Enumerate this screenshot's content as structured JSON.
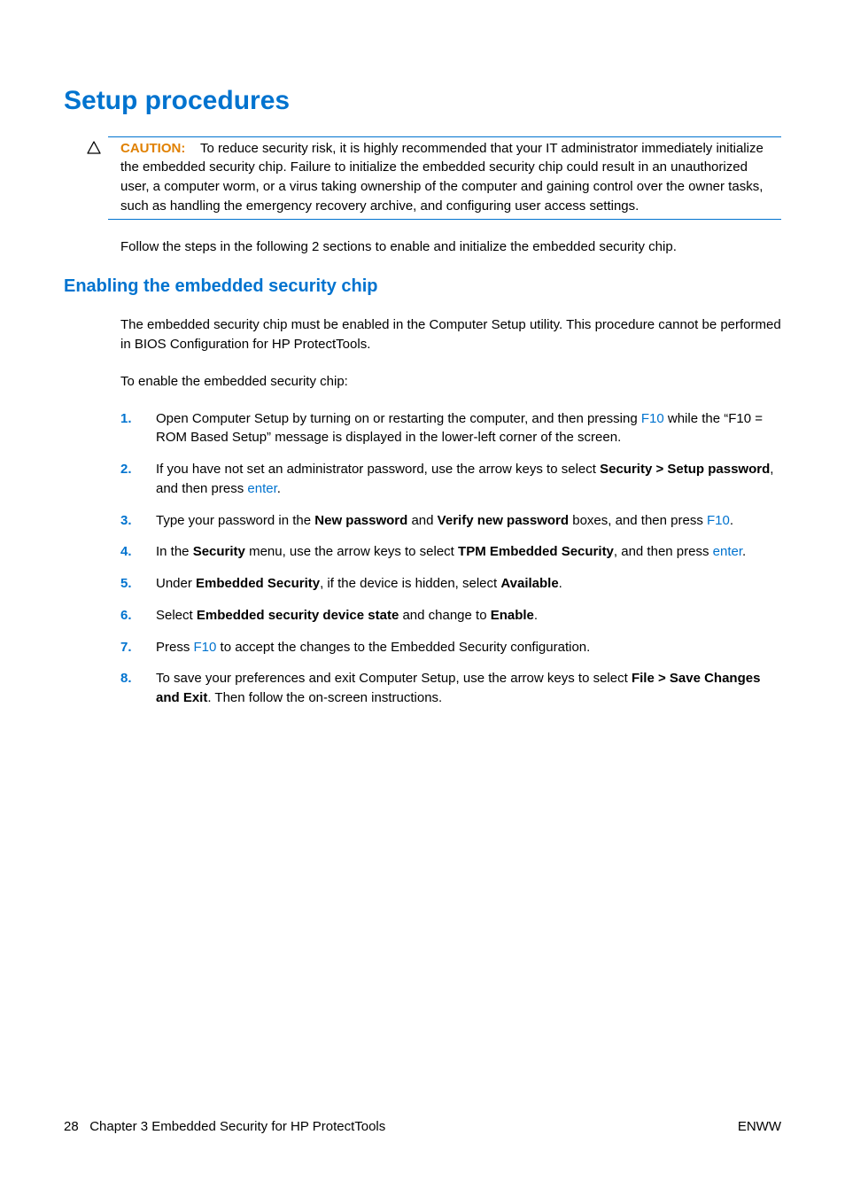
{
  "title": "Setup procedures",
  "caution": {
    "label": "CAUTION:",
    "text": "To reduce security risk, it is highly recommended that your IT administrator immediately initialize the embedded security chip. Failure to initialize the embedded security chip could result in an unauthorized user, a computer worm, or a virus taking ownership of the computer and gaining control over the owner tasks, such as handling the emergency recovery archive, and configuring user access settings."
  },
  "intro_para": "Follow the steps in the following 2 sections to enable and initialize the embedded security chip.",
  "section": {
    "heading": "Enabling the embedded security chip",
    "para1": "The embedded security chip must be enabled in the Computer Setup utility. This procedure cannot be performed in BIOS Configuration for HP ProtectTools.",
    "para2": "To enable the embedded security chip:",
    "steps": {
      "s1": {
        "num": "1.",
        "a": "Open Computer Setup by turning on or restarting the computer, and then pressing ",
        "k1": "F10",
        "b": " while the “F10 = ROM Based Setup” message is displayed in the lower-left corner of the screen."
      },
      "s2": {
        "num": "2.",
        "a": "If you have not set an administrator password, use the arrow keys to select ",
        "bold1": "Security > Setup password",
        "b": ", and then press ",
        "k1": "enter",
        "c": "."
      },
      "s3": {
        "num": "3.",
        "a": "Type your password in the ",
        "bold1": "New password",
        "b": " and ",
        "bold2": "Verify new password",
        "c": " boxes, and then press ",
        "k1": "F10",
        "d": "."
      },
      "s4": {
        "num": "4.",
        "a": "In the ",
        "bold1": "Security",
        "b": " menu, use the arrow keys to select ",
        "bold2": "TPM Embedded Security",
        "c": ", and then press ",
        "k1": "enter",
        "d": "."
      },
      "s5": {
        "num": "5.",
        "a": "Under ",
        "bold1": "Embedded Security",
        "b": ", if the device is hidden, select ",
        "bold2": "Available",
        "c": "."
      },
      "s6": {
        "num": "6.",
        "a": "Select ",
        "bold1": "Embedded security device state",
        "b": " and change to ",
        "bold2": "Enable",
        "c": "."
      },
      "s7": {
        "num": "7.",
        "a": "Press ",
        "k1": "F10",
        "b": " to accept the changes to the Embedded Security configuration."
      },
      "s8": {
        "num": "8.",
        "a": "To save your preferences and exit Computer Setup, use the arrow keys to select ",
        "bold1": "File > Save Changes and Exit",
        "b": ". Then follow the on-screen instructions."
      }
    }
  },
  "footer": {
    "page": "28",
    "chapter": "Chapter 3   Embedded Security for HP ProtectTools",
    "right": "ENWW"
  }
}
